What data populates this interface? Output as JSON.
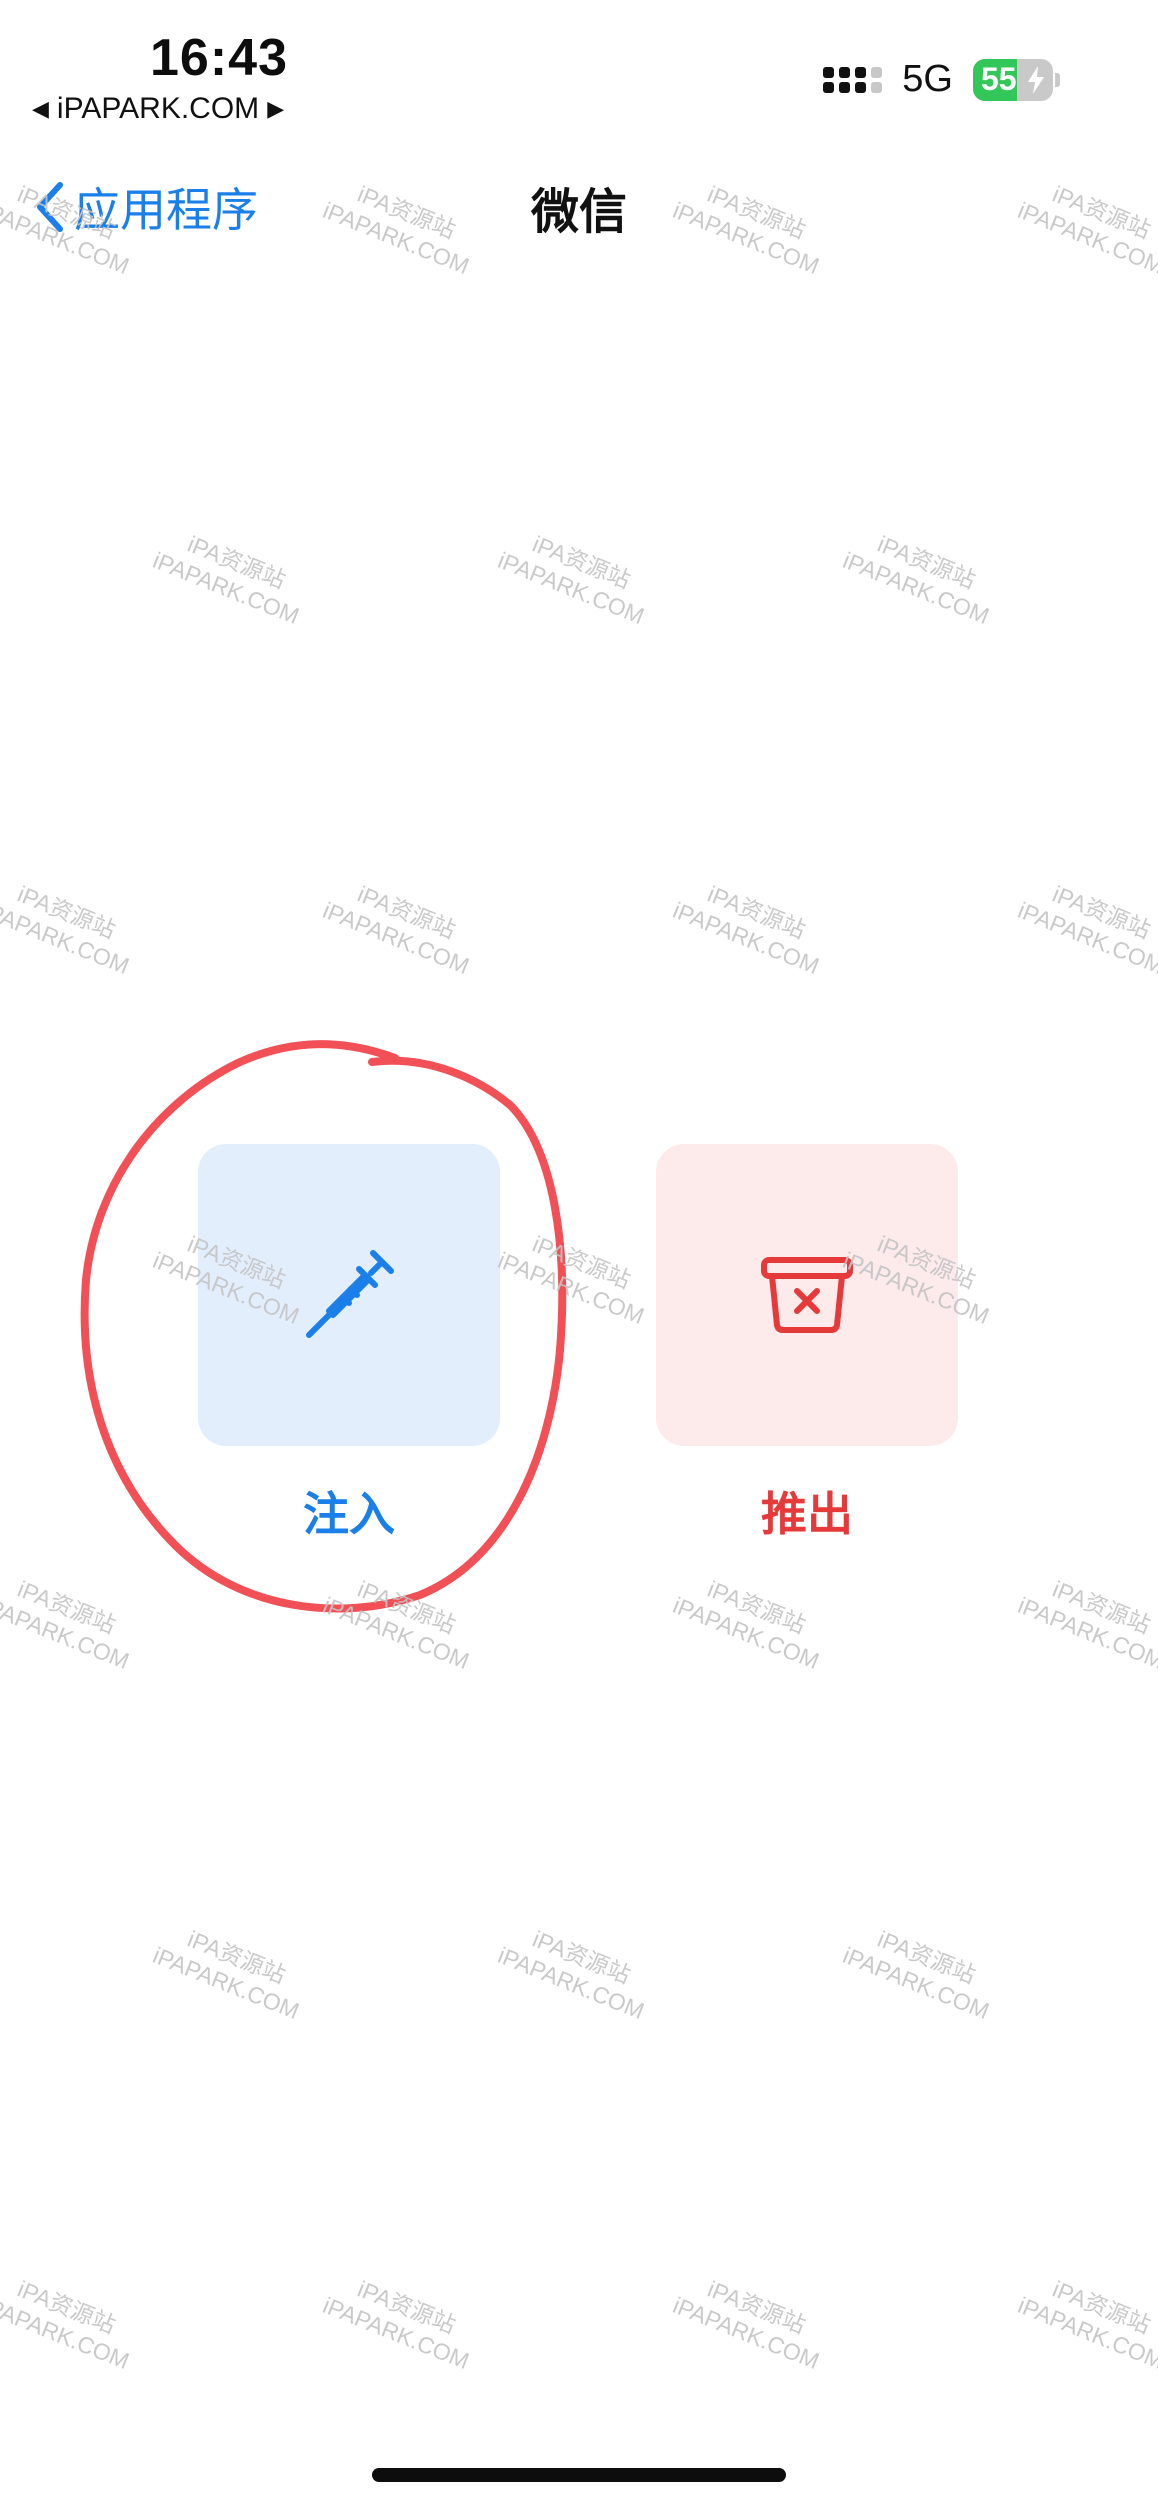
{
  "status_bar": {
    "time": "16:43",
    "back_app": "iPAPARK.COM",
    "network": "5G",
    "battery_level": 55,
    "battery_text": "55",
    "battery_charging": true
  },
  "nav": {
    "back_label": "应用程序",
    "title": "微信"
  },
  "actions": {
    "inject": {
      "label": "注入",
      "icon": "syringe-icon",
      "accent": "#1a7fe8",
      "tile_bg": "#e3eefd"
    },
    "eject": {
      "label": "推出",
      "icon": "trash-bin-x-icon",
      "accent": "#e6393a",
      "tile_bg": "#fdeaea"
    }
  },
  "annotation": {
    "color": "#f05056",
    "shape": "hand-drawn-circle"
  },
  "watermark": {
    "line1": "iPA资源站",
    "line2": "iPAPARK.COM"
  }
}
